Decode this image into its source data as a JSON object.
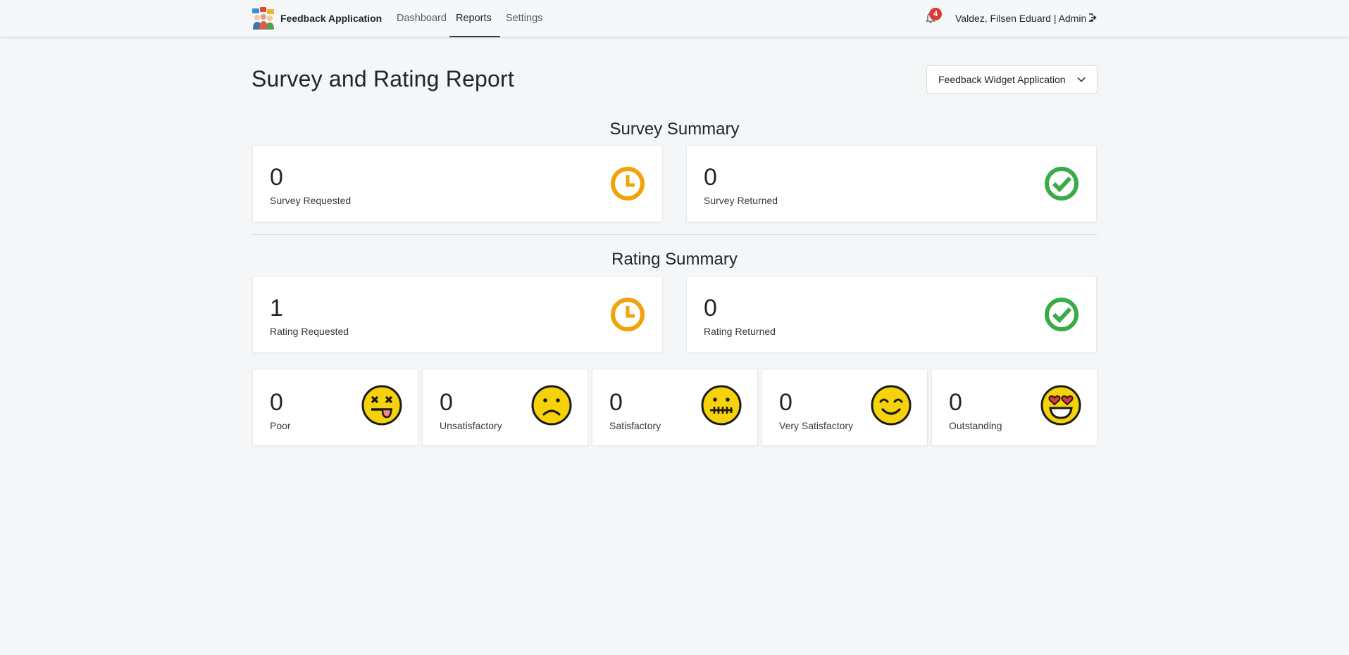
{
  "navbar": {
    "brand": "Feedback Application",
    "links": [
      "Dashboard",
      "Reports",
      "Settings"
    ],
    "active_link": "Reports",
    "notification_count": "4",
    "user": "Valdez, Filsen Eduard | Admin"
  },
  "header": {
    "title": "Survey and Rating Report",
    "app_select": {
      "value": "Feedback Widget Application"
    }
  },
  "survey_summary": {
    "title": "Survey Summary",
    "cards": [
      {
        "value": "0",
        "label": "Survey Requested",
        "icon": "clock-icon"
      },
      {
        "value": "0",
        "label": "Survey Returned",
        "icon": "check-circle-icon"
      }
    ]
  },
  "rating_summary": {
    "title": "Rating Summary",
    "cards": [
      {
        "value": "1",
        "label": "Rating Requested",
        "icon": "clock-icon"
      },
      {
        "value": "0",
        "label": "Rating Returned",
        "icon": "check-circle-icon"
      }
    ],
    "ratings": [
      {
        "value": "0",
        "label": "Poor",
        "icon": "dizzy-face-icon"
      },
      {
        "value": "0",
        "label": "Unsatisfactory",
        "icon": "frown-face-icon"
      },
      {
        "value": "0",
        "label": "Satisfactory",
        "icon": "grimace-face-icon"
      },
      {
        "value": "0",
        "label": "Very Satisfactory",
        "icon": "smile-face-icon"
      },
      {
        "value": "0",
        "label": "Outstanding",
        "icon": "heart-eyes-face-icon"
      }
    ]
  },
  "colors": {
    "clock": "#f0a30a",
    "check": "#3bab4a",
    "emoji": "#f5d20a",
    "badge": "#d93a3a"
  }
}
